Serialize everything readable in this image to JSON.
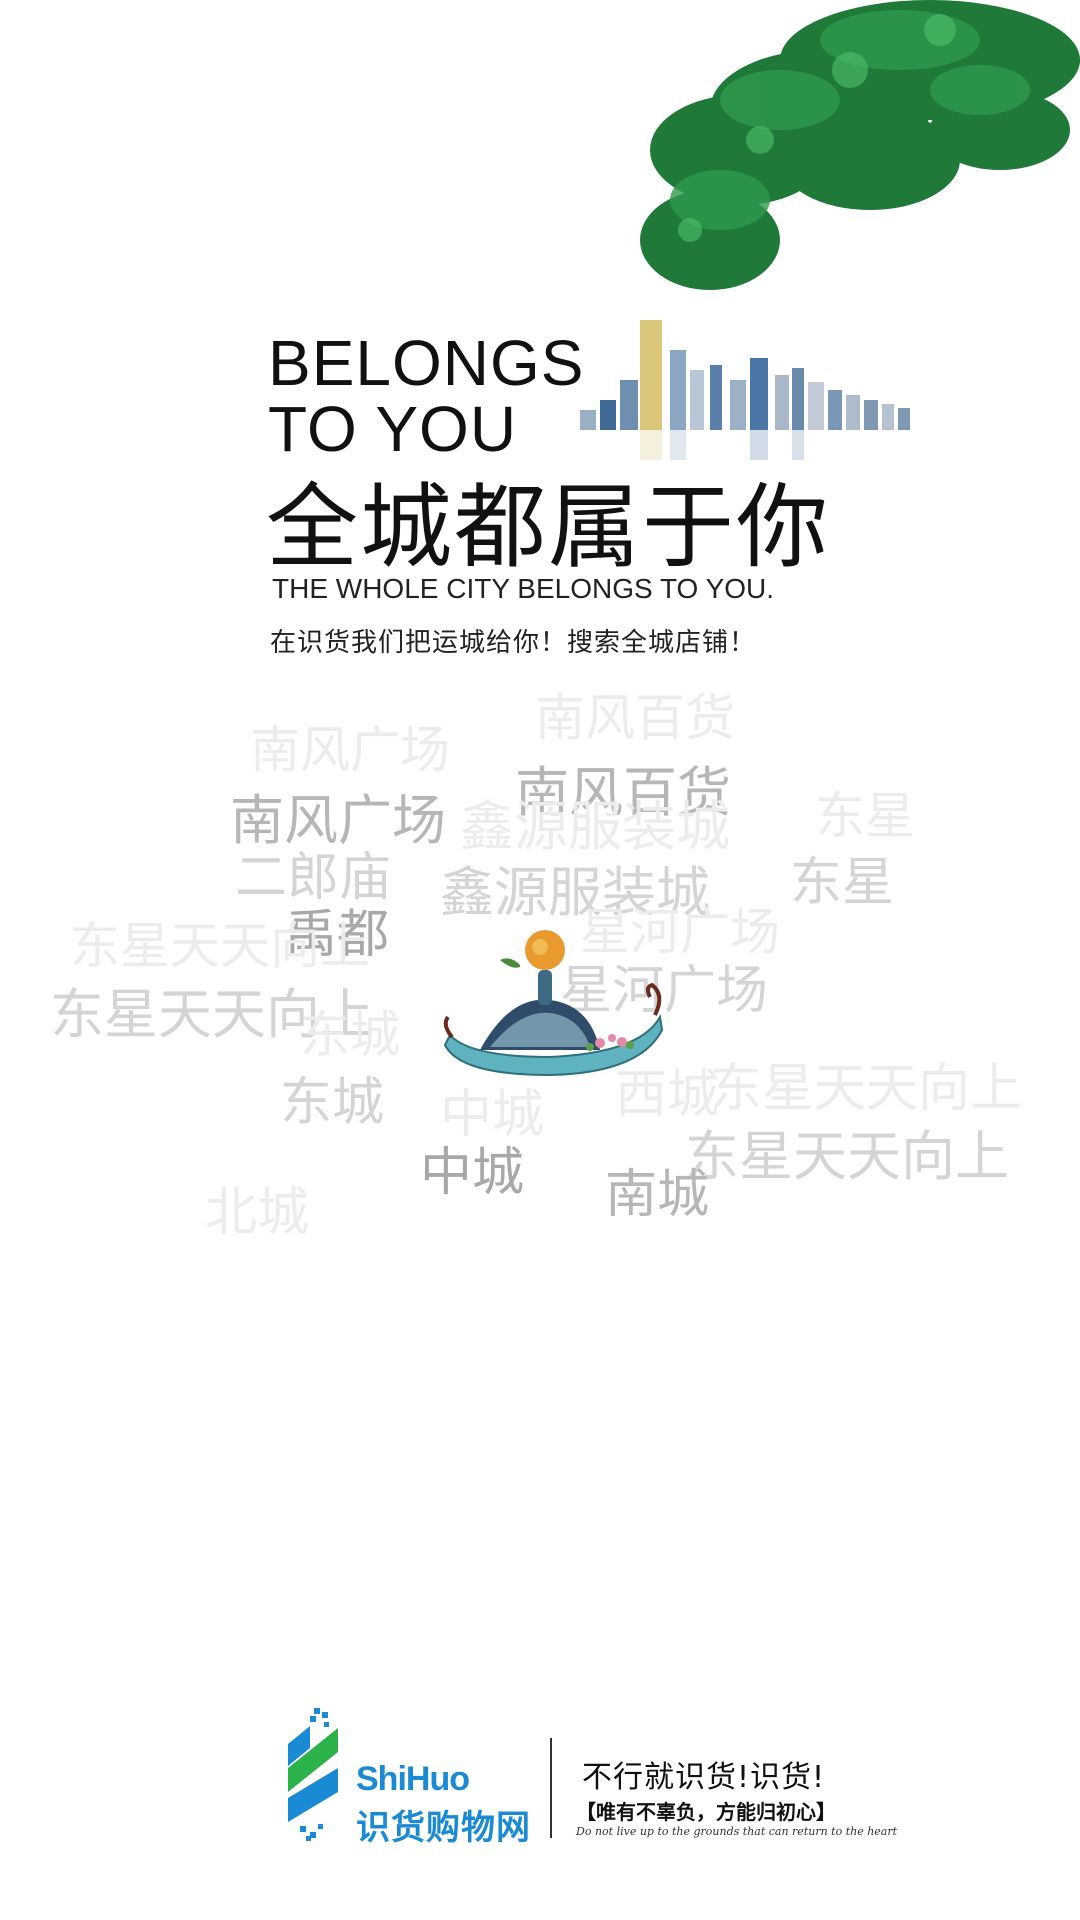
{
  "hero": {
    "en_line1": "BELONGS",
    "en_line2": "TO YOU",
    "cn_title": "全城都属于你",
    "en_subtitle": "THE WHOLE CITY BELONGS TO YOU.",
    "cn_subtitle": "在识货我们把运城给你！搜索全城店铺！"
  },
  "cloud": {
    "w1": "南风百货",
    "w2": "南风广场",
    "w3": "南风百货",
    "w4": "南风广场",
    "w5": "东星",
    "w6": "鑫源服装城",
    "w7": "二郎庙",
    "w8": "鑫源服装城",
    "w9": "东星",
    "w10": "禹都",
    "w11": "东星天天向上",
    "w12": "星河广场",
    "w13": "东星天天向上",
    "w14": "星河广场",
    "w15": "东城",
    "w16": "东城",
    "w17": "东星天天向上",
    "w18": "中城",
    "w19": "西城",
    "w20": "东星天天向上",
    "w21": "中城",
    "w22": "南城",
    "w23": "北城"
  },
  "footer": {
    "brand_en": "ShiHuo",
    "brand_cn": "识货购物网",
    "slogan": "不行就识货!识货!",
    "motto": "【唯有不辜负，方能归初心】",
    "motto_en": "Do not live up to the grounds that can return to the heart"
  },
  "colors": {
    "brand_blue": "#1a8ad4",
    "brand_green": "#2bb24a",
    "tree_green": "#1f7a3a"
  }
}
